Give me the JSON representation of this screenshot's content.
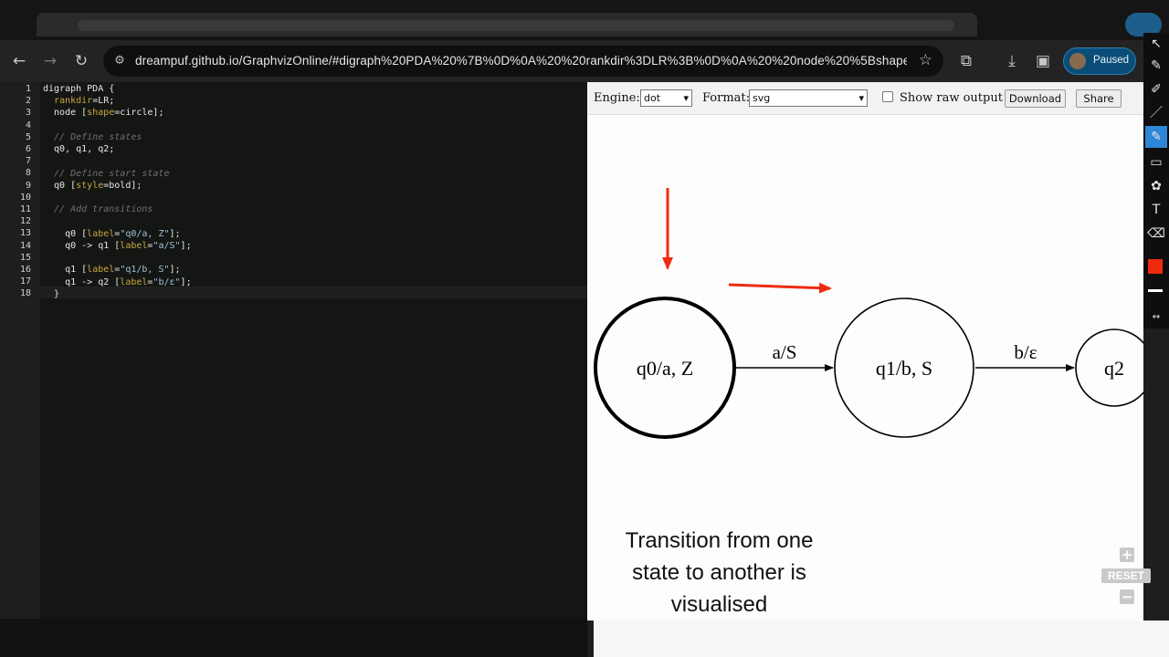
{
  "browser": {
    "url": "dreampuf.github.io/GraphvizOnline/#digraph%20PDA%20%7B%0D%0A%20%20rankdir%3DLR%3B%0D%0A%20%20node%20%5Bshape%3Dcir...",
    "profile_status": "Paused"
  },
  "editor": {
    "line_numbers": [
      "1",
      "2",
      "3",
      "4",
      "5",
      "6",
      "7",
      "8",
      "9",
      "10",
      "11",
      "12",
      "13",
      "14",
      "15",
      "16",
      "17",
      "18"
    ]
  },
  "controls": {
    "engine_label": "Engine:",
    "engine_value": "dot",
    "format_label": "Format:",
    "format_value": "svg",
    "raw_output_label": "Show raw output",
    "download_label": "Download",
    "share_label": "Share"
  },
  "graph": {
    "nodes": {
      "q0": "q0/a, Z",
      "q1": "q1/b, S",
      "q2": "q2"
    },
    "edges": {
      "q0_q1": "a/S",
      "q1_q2": "b/ε"
    }
  },
  "caption": {
    "line1": "Transition from one",
    "line2": "state to another is",
    "line3": "visualised"
  },
  "zoom": {
    "reset_label": "RESET"
  },
  "colors": {
    "annotation_red": "#ee2b10",
    "accent_blue": "#2e86d6"
  }
}
